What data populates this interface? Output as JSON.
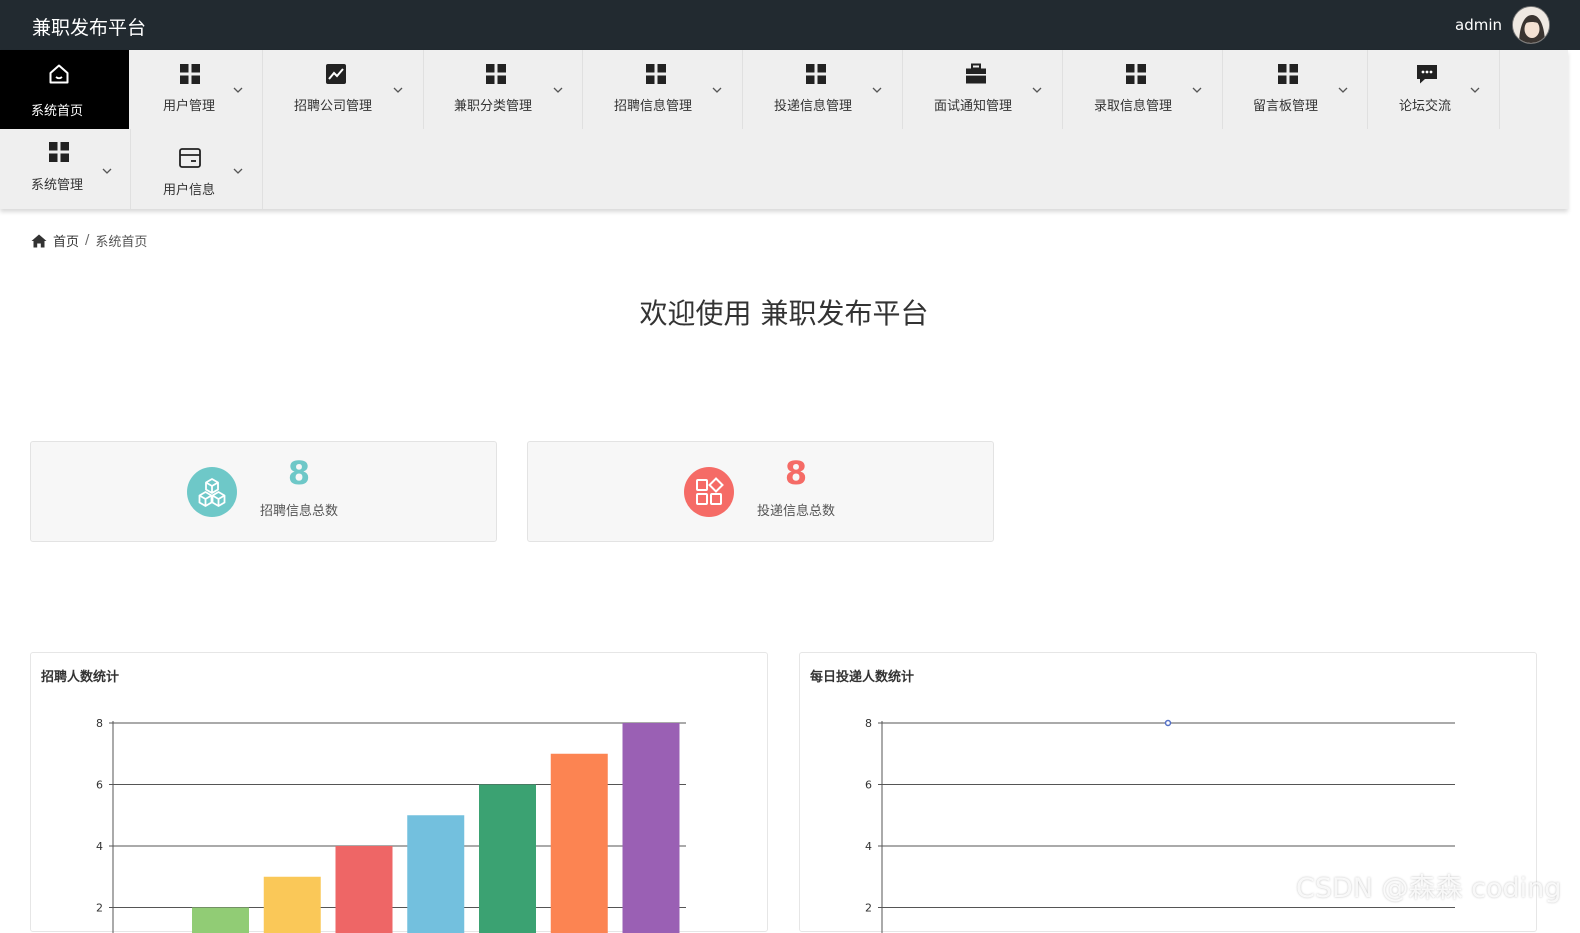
{
  "header": {
    "brand": "兼职发布平台",
    "username": "admin"
  },
  "nav": {
    "items": [
      {
        "label": "系统首页",
        "icon": "home-icon",
        "active": true
      },
      {
        "label": "用户管理",
        "icon": "grid-icon"
      },
      {
        "label": "招聘公司管理",
        "icon": "trend-chart-icon"
      },
      {
        "label": "兼职分类管理",
        "icon": "grid-icon"
      },
      {
        "label": "招聘信息管理",
        "icon": "grid-icon"
      },
      {
        "label": "投递信息管理",
        "icon": "grid-icon"
      },
      {
        "label": "面试通知管理",
        "icon": "briefcase-icon"
      },
      {
        "label": "录取信息管理",
        "icon": "grid-icon"
      },
      {
        "label": "留言板管理",
        "icon": "grid-icon"
      },
      {
        "label": "论坛交流",
        "icon": "chat-icon"
      },
      {
        "label": "系统管理",
        "icon": "grid-icon"
      },
      {
        "label": "用户信息",
        "icon": "card-icon"
      }
    ]
  },
  "breadcrumb": {
    "home": "首页",
    "separator": "/",
    "current": "系统首页"
  },
  "welcome": "欢迎使用 兼职发布平台",
  "stats": [
    {
      "value": "8",
      "label": "招聘信息总数",
      "color": "#6ec8c8",
      "icon": "cubes-icon"
    },
    {
      "value": "8",
      "label": "投递信息总数",
      "color": "#f56b66",
      "icon": "apps-icon"
    }
  ],
  "chart_data": [
    {
      "type": "bar",
      "title": "招聘人数统计",
      "y_ticks": [
        2,
        4,
        6,
        8
      ],
      "values": [
        2,
        3,
        4,
        5,
        6,
        7,
        8
      ],
      "colors": [
        "#91cc75",
        "#fac858",
        "#ee6666",
        "#73c0de",
        "#3ba272",
        "#fc8452",
        "#9a60b4"
      ]
    },
    {
      "type": "line",
      "title": "每日投递人数统计",
      "y_ticks": [
        2,
        4,
        6,
        8
      ],
      "values": [
        8
      ],
      "line_color": "#5470c6"
    }
  ],
  "watermark": "CSDN @森森 coding"
}
